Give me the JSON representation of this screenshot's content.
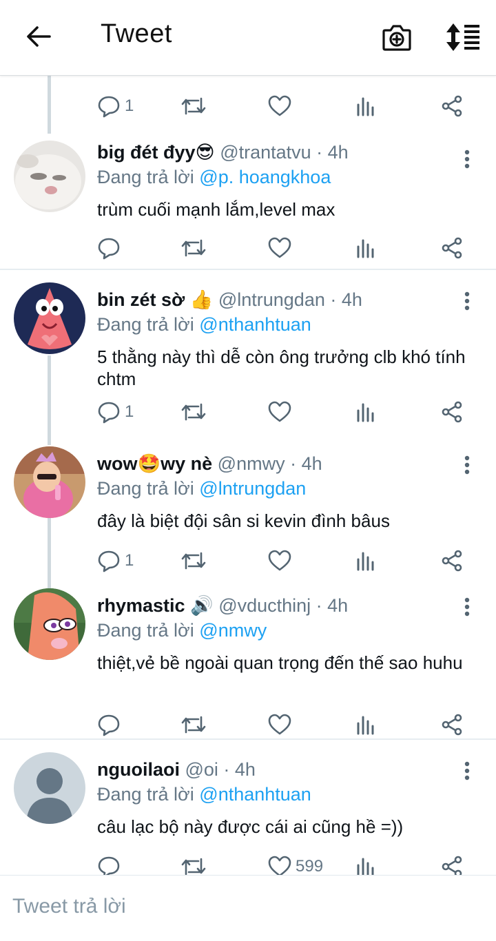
{
  "header": {
    "title": "Tweet"
  },
  "tweets": [
    {
      "name": "",
      "handle": "",
      "replying_to_label": "",
      "replying_to": "",
      "text": "",
      "reply_count": "1",
      "like_count": ""
    },
    {
      "name": "big đét đyy😎",
      "handle": "@trantatvu · 4h",
      "replying_to_label": "Đang trả lời",
      "replying_to": "@p. hoangkhoa",
      "text": "trùm cuối mạnh lắm,level max",
      "reply_count": "",
      "like_count": ""
    },
    {
      "name": "bin zét sờ 👍",
      "handle": "@lntrungdan · 4h",
      "replying_to_label": "Đang trả lời",
      "replying_to": "@nthanhtuan",
      "text": "5 thằng này thì dễ còn ông trưởng clb khó tính chtm",
      "reply_count": "1",
      "like_count": ""
    },
    {
      "name": "wow🤩wy nè",
      "handle": "@nmwy · 4h",
      "replying_to_label": "Đang trả lời",
      "replying_to": "@lntrungdan",
      "text": "đây là biệt đội sân si kevin đình bâus",
      "reply_count": "1",
      "like_count": ""
    },
    {
      "name": "rhymastic 🔊",
      "handle": "@vducthinj · 4h",
      "replying_to_label": "Đang trả lời",
      "replying_to": "@nmwy",
      "text": "thiệt,vẻ bề ngoài quan trọng đến thế sao huhu",
      "reply_count": "",
      "like_count": ""
    },
    {
      "name": "nguoilaoi",
      "handle": "@oi · 4h",
      "replying_to_label": "Đang trả lời",
      "replying_to": "@nthanhtuan",
      "text": "câu lạc bộ này được cái ai cũng hề =))",
      "reply_count": "",
      "like_count": "599"
    }
  ],
  "compose": {
    "placeholder": "Tweet trả lời"
  },
  "colors": {
    "mention": "#1da1f2",
    "secondary_text": "#657786",
    "thread_line": "#cfd9de"
  },
  "icons": [
    "back-arrow-icon",
    "camera-add-icon",
    "sort-icon",
    "reply-icon",
    "retweet-icon",
    "like-icon",
    "analytics-icon",
    "share-icon",
    "more-vertical-icon"
  ]
}
